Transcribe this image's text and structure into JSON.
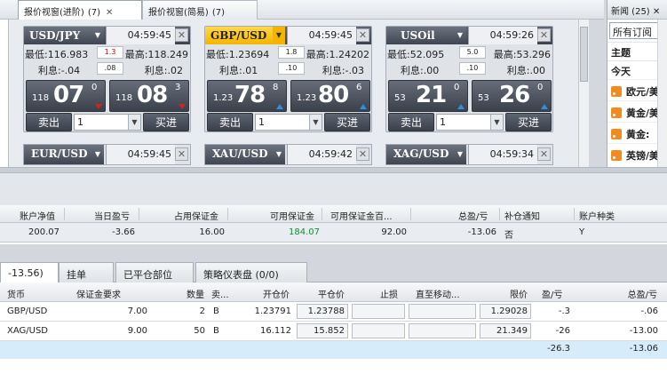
{
  "tabs": [
    {
      "label": "报价视窗(进阶)",
      "count": "(7)",
      "close": "✕"
    },
    {
      "label": "报价视窗(简易)",
      "count": "(7)"
    }
  ],
  "quote_cards": [
    {
      "symbol": "USD/JPY",
      "dropdown": "▼",
      "time": "04:59:45",
      "close": "✕",
      "low": "最低:116.983",
      "high": "最高:118.249",
      "spread": "1.3",
      "interest_left": "利息:-.04",
      "interest_input": ".08",
      "interest_right": "利息:.02",
      "sell": {
        "prefix": "118",
        "big": "07",
        "sup": "0",
        "dir": "down"
      },
      "buy": {
        "prefix": "118",
        "big": "08",
        "sup": "3",
        "dir": "down"
      },
      "sell_label": "卖出",
      "qty": "1",
      "buy_label": "买进"
    },
    {
      "symbol": "GBP/USD",
      "dropdown": "▼",
      "time": "04:59:45",
      "close": "✕",
      "low": "最低:1.23694",
      "high": "最高:1.24202",
      "spread": "1.8",
      "interest_left": "利息:.01",
      "interest_input": ".10",
      "interest_right": "利息:-.03",
      "sell": {
        "prefix": "1.23",
        "big": "78",
        "sup": "8",
        "dir": "up"
      },
      "buy": {
        "prefix": "1.23",
        "big": "80",
        "sup": "6",
        "dir": "up"
      },
      "sell_label": "卖出",
      "qty": "1",
      "buy_label": "买进"
    },
    {
      "symbol": "USOil",
      "dropdown": "▼",
      "time": "04:59:26",
      "close": "✕",
      "low": "最低:52.095",
      "high": "最高:53.296",
      "spread": "5.0",
      "interest_left": "利息:.00",
      "interest_input": ".10",
      "interest_right": "利息:.00",
      "sell": {
        "prefix": "53",
        "big": "21",
        "sup": "0",
        "dir": "up"
      },
      "buy": {
        "prefix": "53",
        "big": "26",
        "sup": "0",
        "dir": "up"
      },
      "sell_label": "卖出",
      "qty": "1",
      "buy_label": "买进"
    }
  ],
  "mini_cards": [
    {
      "symbol": "EUR/USD",
      "dropdown": "▼",
      "time": "04:59:45",
      "close": "✕"
    },
    {
      "symbol": "XAU/USD",
      "dropdown": "▼",
      "time": "04:59:42",
      "close": "✕"
    },
    {
      "symbol": "XAG/USD",
      "dropdown": "▼",
      "time": "04:59:34",
      "close": "✕"
    }
  ],
  "news": {
    "header": "新闻 (25)",
    "close": "✕",
    "select": "所有订阅",
    "labels": [
      "主题",
      "今天"
    ],
    "items": [
      "欧元/美",
      "黄金/美",
      "黄金:",
      "英镑/美"
    ]
  },
  "account": {
    "headers": [
      "账户净值",
      "当日盈亏",
      "占用保证金",
      "可用保证金",
      "可用保证金百...",
      "总盈/亏",
      "补仓通知",
      "账户种类"
    ],
    "values": [
      "200.07",
      "-3.66",
      "16.00",
      "184.07",
      "92.00",
      "-13.06",
      "否",
      "Y"
    ],
    "accent_green": "#1a8a3a"
  },
  "bottom_tabs": [
    "-13.56)",
    "挂单",
    "已平仓部位",
    "策略仪表盘 (0/0)"
  ],
  "positions": {
    "headers": [
      "货币",
      "保证金要求",
      "数量",
      "卖...",
      "开仓价",
      "平仓价",
      "止损",
      "直至移动...",
      "限价",
      "盈/亏",
      "总盈/亏"
    ],
    "rows": [
      {
        "currency": "GBP/USD",
        "margin": "7.00",
        "qty": "2",
        "side": "B",
        "open": "1.23791",
        "close": "1.23788",
        "stop": "",
        "trail": "",
        "limit": "1.29028",
        "pl": "-.3",
        "total": "-.06"
      },
      {
        "currency": "XAG/USD",
        "margin": "9.00",
        "qty": "50",
        "side": "B",
        "open": "16.112",
        "close": "15.852",
        "stop": "",
        "trail": "",
        "limit": "21.349",
        "pl": "-26",
        "total": "-13.00"
      }
    ],
    "total_pl": "-26.3",
    "total_total": "-13.06"
  }
}
